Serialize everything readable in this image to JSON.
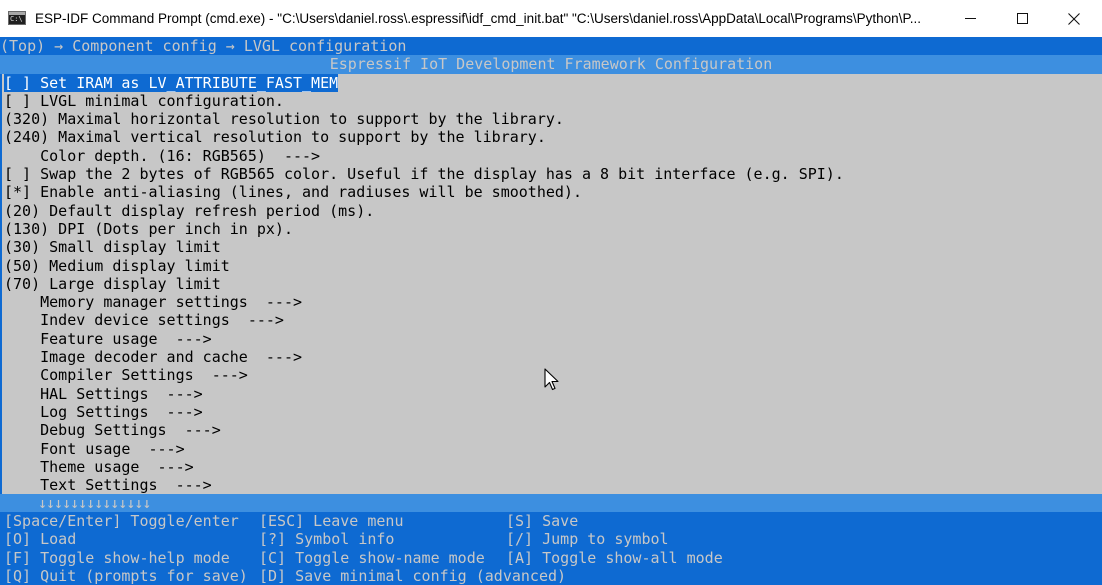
{
  "window": {
    "title": "ESP-IDF Command Prompt (cmd.exe) - \"C:\\Users\\daniel.ross\\.espressif\\idf_cmd_init.bat\"  \"C:\\Users\\daniel.ross\\AppData\\Local\\Programs\\Python\\P...",
    "icon": "cmd-icon"
  },
  "menuconfig": {
    "breadcrumb": "(Top) → Component config → LVGL configuration",
    "header": "Espressif IoT Development Framework Configuration",
    "items": [
      {
        "text": "[ ] Set IRAM as LV_ATTRIBUTE_FAST_MEM",
        "selected": true
      },
      {
        "text": "[ ] LVGL minimal configuration."
      },
      {
        "text": "(320) Maximal horizontal resolution to support by the library."
      },
      {
        "text": "(240) Maximal vertical resolution to support by the library."
      },
      {
        "text": "    Color depth. (16: RGB565)  --->"
      },
      {
        "text": "[ ] Swap the 2 bytes of RGB565 color. Useful if the display has a 8 bit interface (e.g. SPI)."
      },
      {
        "text": "[*] Enable anti-aliasing (lines, and radiuses will be smoothed)."
      },
      {
        "text": "(20) Default display refresh period (ms)."
      },
      {
        "text": "(130) DPI (Dots per inch in px)."
      },
      {
        "text": "(30) Small display limit"
      },
      {
        "text": "(50) Medium display limit"
      },
      {
        "text": "(70) Large display limit"
      },
      {
        "text": "    Memory manager settings  --->"
      },
      {
        "text": "    Indev device settings  --->"
      },
      {
        "text": "    Feature usage  --->"
      },
      {
        "text": "    Image decoder and cache  --->"
      },
      {
        "text": "    Compiler Settings  --->"
      },
      {
        "text": "    HAL Settings  --->"
      },
      {
        "text": "    Log Settings  --->"
      },
      {
        "text": "    Debug Settings  --->"
      },
      {
        "text": "    Font usage  --->"
      },
      {
        "text": "    Theme usage  --->"
      },
      {
        "text": "    Text Settings  --->"
      }
    ],
    "scroll_indicator": "↓↓↓↓↓↓↓↓↓↓↓↓↓↓",
    "help": {
      "col1": [
        "[Space/Enter] Toggle/enter",
        "[O] Load",
        "[F] Toggle show-help mode",
        "[Q] Quit (prompts for save)"
      ],
      "col2": [
        "[ESC] Leave menu",
        "[?] Symbol info",
        "[C] Toggle show-name mode",
        "[D] Save minimal config (advanced)"
      ],
      "col3": [
        "[S] Save",
        "[/] Jump to symbol",
        "[A] Toggle show-all mode"
      ]
    }
  },
  "colors": {
    "terminal_bg": "#c7c7c7",
    "accent_blue": "#0e6ad2",
    "header_blue": "#3d8fe0"
  }
}
